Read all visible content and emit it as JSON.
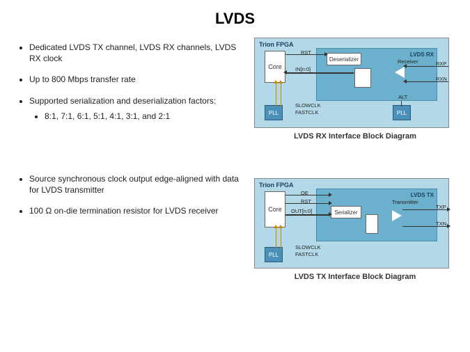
{
  "title": "LVDS",
  "bullets_top": [
    "Dedicated LVDS TX channel, LVDS RX channels, LVDS RX clock",
    "Up to 800 Mbps transfer rate",
    "Supported serialization and deserialization factors:"
  ],
  "sub_bullet": "8:1, 7:1, 6:1, 5:1, 4:1, 3:1, and 2:1",
  "bullets_bottom": [
    "Source synchronous clock output edge-aligned with data for LVDS transmitter",
    "100 Ω on-die termination resistor for LVDS receiver"
  ],
  "rx": {
    "fpga": "Trion FPGA",
    "core": "Core",
    "pll1": "PLL",
    "pll2": "PLL",
    "deser": "Deserializer",
    "lvds_title": "LVDS RX",
    "receiver": "Receiver",
    "rst": "RST",
    "in": "IN[n:0]",
    "slowclk": "SLOWCLK",
    "fastclk": "FASTCLK",
    "alt": "ALT",
    "rxp": "RXP",
    "rxn": "RXN",
    "caption": "LVDS RX Interface Block Diagram"
  },
  "tx": {
    "fpga": "Trion FPGA",
    "core": "Core",
    "pll1": "PLL",
    "serializer": "Serializer",
    "lvds_title": "LVDS TX",
    "transmitter": "Transmitter",
    "oe": "OE",
    "rst": "RST",
    "out": "OUT[n:0]",
    "slowclk": "SLOWCLK",
    "fastclk": "FASTCLK",
    "txp": "TXP",
    "txn": "TXN",
    "caption": "LVDS TX Interface Block Diagram"
  }
}
